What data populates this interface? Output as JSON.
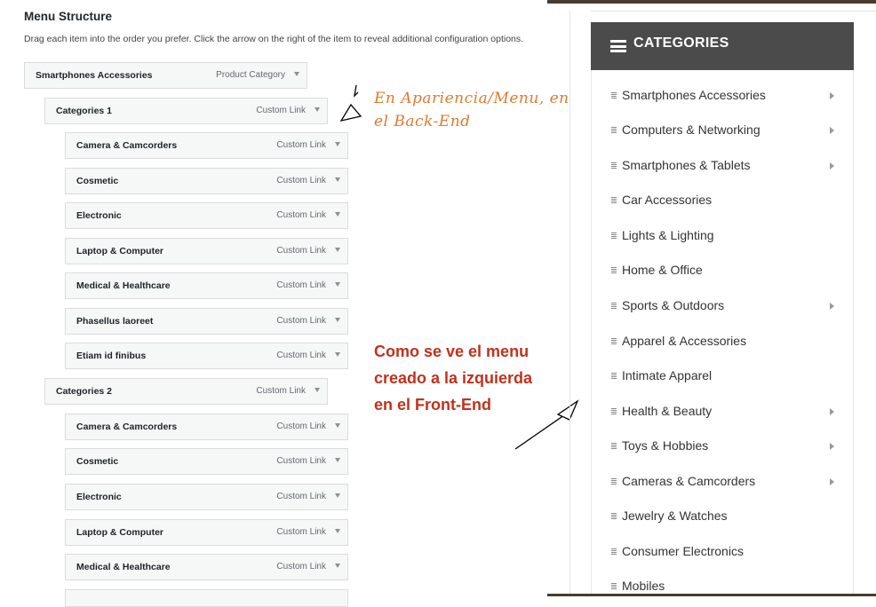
{
  "menu_structure": {
    "title": "Menu Structure",
    "description": "Drag each item into the order you prefer. Click the arrow on the right of the item to reveal additional configuration options.",
    "items": [
      {
        "label": "Smartphones Accessories",
        "type": "Product Category"
      },
      {
        "label": "Categories 1",
        "type": "Custom Link"
      },
      {
        "label": "Camera & Camcorders",
        "type": "Custom Link"
      },
      {
        "label": "Cosmetic",
        "type": "Custom Link"
      },
      {
        "label": "Electronic",
        "type": "Custom Link"
      },
      {
        "label": "Laptop & Computer",
        "type": "Custom Link"
      },
      {
        "label": "Medical & Healthcare",
        "type": "Custom Link"
      },
      {
        "label": "Phasellus laoreet",
        "type": "Custom Link"
      },
      {
        "label": "Etiam id finibus",
        "type": "Custom Link"
      },
      {
        "label": "Categories 2",
        "type": "Custom Link"
      },
      {
        "label": "Camera & Camcorders",
        "type": "Custom Link"
      },
      {
        "label": "Cosmetic",
        "type": "Custom Link"
      },
      {
        "label": "Electronic",
        "type": "Custom Link"
      },
      {
        "label": "Laptop & Computer",
        "type": "Custom Link"
      },
      {
        "label": "Medical & Healthcare",
        "type": "Custom Link"
      }
    ]
  },
  "annotations": {
    "backend_note": "En Apariencia/Menu, en el Back-End",
    "frontend_note_1": "Como se ve el menu",
    "frontend_note_2": "creado a la izquierda",
    "frontend_note_3": "en el Front-End"
  },
  "categories_widget": {
    "title": "CATEGORIES",
    "items": [
      {
        "label": "Smartphones Accessories",
        "has_submenu": true
      },
      {
        "label": "Computers & Networking",
        "has_submenu": true
      },
      {
        "label": "Smartphones & Tablets",
        "has_submenu": true
      },
      {
        "label": "Car Accessories",
        "has_submenu": false
      },
      {
        "label": "Lights & Lighting",
        "has_submenu": false
      },
      {
        "label": "Home & Office",
        "has_submenu": false
      },
      {
        "label": "Sports & Outdoors",
        "has_submenu": true
      },
      {
        "label": "Apparel & Accessories",
        "has_submenu": false
      },
      {
        "label": "Intimate Apparel",
        "has_submenu": false
      },
      {
        "label": "Health & Beauty",
        "has_submenu": true
      },
      {
        "label": "Toys & Hobbies",
        "has_submenu": true
      },
      {
        "label": "Cameras & Camcorders",
        "has_submenu": true
      },
      {
        "label": "Jewelry & Watches",
        "has_submenu": false
      },
      {
        "label": "Consumer Electronics",
        "has_submenu": false
      },
      {
        "label": "Mobiles",
        "has_submenu": false
      }
    ]
  },
  "colors": {
    "header_bg": "#4b4b4b",
    "note_orange": "#e07a2e",
    "note_red": "#c0321c",
    "dark_bar": "#4a3b30"
  }
}
